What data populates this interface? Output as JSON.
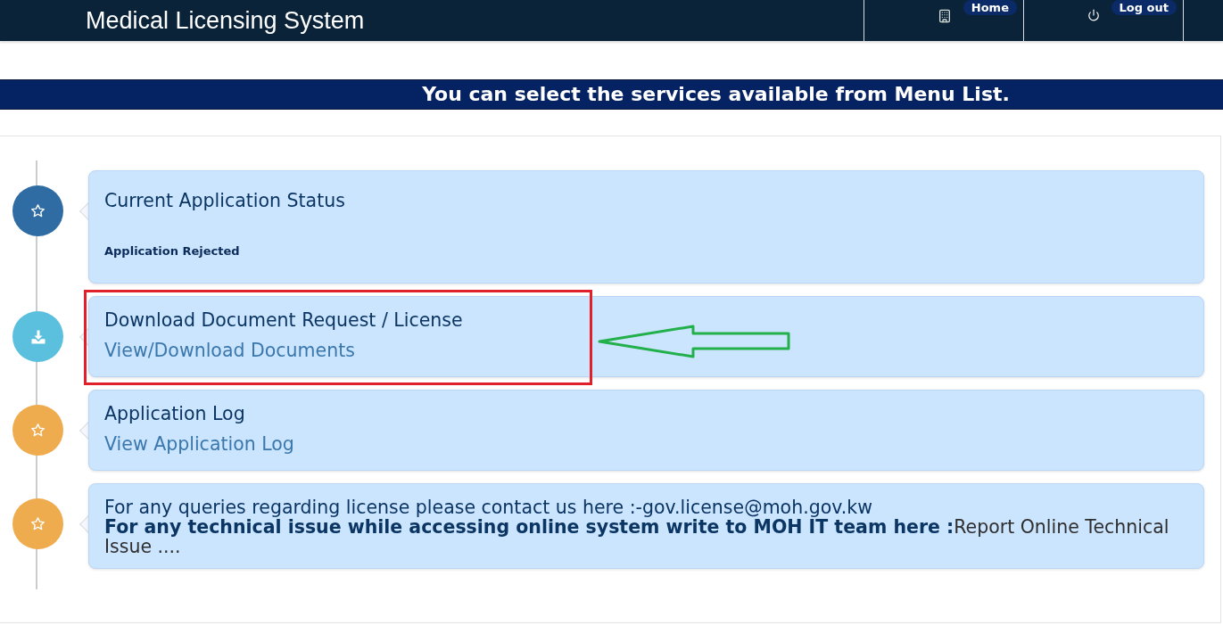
{
  "header": {
    "title": "Medical Licensing System",
    "nav": [
      {
        "kind": "home",
        "label": "Home"
      },
      {
        "kind": "logout",
        "label": "Log out"
      }
    ]
  },
  "banner": {
    "text": "You can select the services available from Menu List."
  },
  "timeline": [
    {
      "kind": "status",
      "color": "#2e6ca3",
      "highlighted": false,
      "title": "Current Application Status",
      "status": "Application Rejected"
    },
    {
      "kind": "download",
      "color": "#5bc0de",
      "highlighted": true,
      "title": "Download Document Request / License",
      "link": "View/Download Documents"
    },
    {
      "kind": "log",
      "color": "#efac4e",
      "highlighted": false,
      "title": "Application Log",
      "link": "View Application Log"
    },
    {
      "kind": "contact",
      "color": "#efac4e",
      "highlighted": false,
      "lines": [
        "For any queries regarding license please contact us here :-gov.license@moh.gov.kw",
        "**For any technical issue while accessing online system write to MOH IT team here :**Report Online Technical Issue ...."
      ]
    }
  ]
}
